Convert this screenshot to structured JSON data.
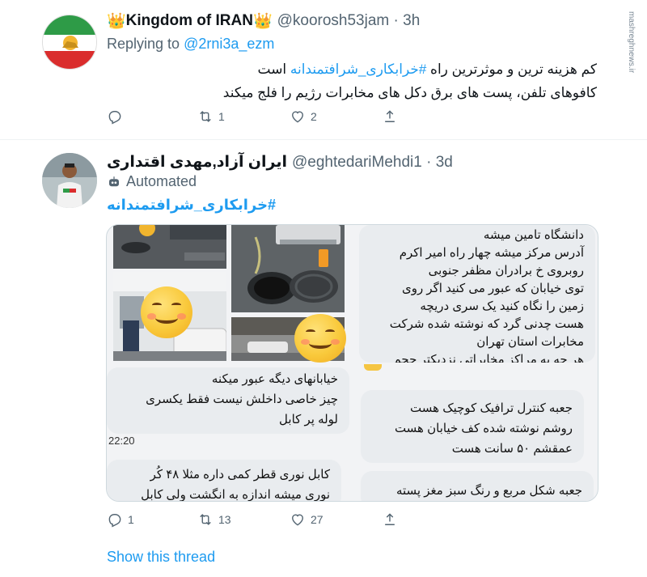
{
  "tweet1": {
    "name": "Kingdom of IRAN",
    "crown_left": "👑",
    "crown_right": "👑",
    "handle": "@koorosh53jam · 3h",
    "replying_prefix": "Replying to",
    "replying_to": "@2rni3a_ezm",
    "line1_before": "کم هزینه ترین و موثرترین راه",
    "line1_hashtag": "#خرابکاری_شرافتمندانه",
    "line1_after": "است",
    "line2": "کافوهای تلفن، پست های برق دکل های مخابرات رژیم را فلج میکند",
    "actions": {
      "reply_count": "",
      "retweet_count": "1",
      "like_count": "2"
    }
  },
  "tweet2": {
    "name": "ایران آزاد,مهدی اقتداری",
    "handle": "@eghtedariMehdi1 · 3d",
    "automated_label": "Automated",
    "hashtag": "#خرابکاری_شرافتمندانه",
    "actions": {
      "reply_count": "1",
      "retweet_count": "13",
      "like_count": "27"
    }
  },
  "chat": {
    "bubble_top_right": [
      "دانشگاه تامین میشه",
      "آدرس مرکز میشه چهار راه امیر اکرم",
      "روبروی خ برادران مظفر جنوبی",
      "توی خیابان که عبور می کنید اگر روی",
      "زمین را نگاه کنید یک سری دریچه",
      "هست چدنی گرد که نوشته شده شرکت",
      "مخابرات استان تهران",
      "هر چه به مراکز مخابراتی نزدیکتر حجم"
    ],
    "bubble_mid_left": [
      "خیابانهای دیگه عبور میکنه",
      "چیز خاصی داخلش نیست فقط یکسری",
      "لوله پر کابل"
    ],
    "time": "22:20",
    "bubble_mid_right": [
      "جعبه کنترل ترافیک کوچیک هست",
      "روشم نوشته شده کف خیابان هست",
      "عمقشم ۵۰ سانت هست"
    ],
    "bubble_bottom_left": [
      "کابل نوری قطر کمی داره مثلا ۴۸ کُر",
      "نوری میشه اندازه به انگشت ولی کابل"
    ],
    "bubble_bottom_right": [
      "جعبه شکل مربع و رنگ سبز مغز پسته"
    ]
  },
  "footer": {
    "show_thread": "Show this thread"
  },
  "watermark_text": "mashreghnews.ir",
  "colors": {
    "link": "#1d9bf0",
    "muted": "#536471",
    "text": "#0f1419"
  },
  "icons": [
    "reply-icon",
    "retweet-icon",
    "like-icon",
    "share-icon",
    "robot-icon"
  ]
}
